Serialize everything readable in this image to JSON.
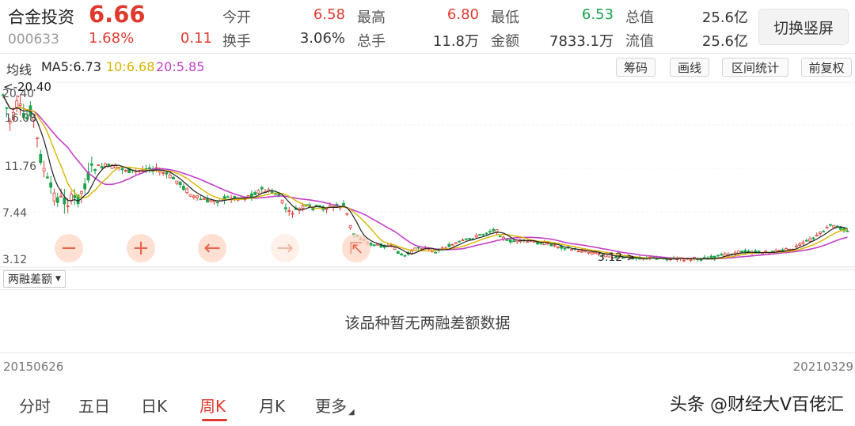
{
  "quote": {
    "name": "合金投资",
    "price": "6.66",
    "code": "000633",
    "change_pct": "1.68%",
    "change": "0.11",
    "fields": [
      {
        "label": "今开",
        "value": "6.58",
        "color": "red"
      },
      {
        "label": "最高",
        "value": "6.80",
        "color": "red"
      },
      {
        "label": "最低",
        "value": "6.53",
        "color": "green"
      },
      {
        "label": "总值",
        "value": "25.6亿",
        "color": "dark"
      },
      {
        "label": "换手",
        "value": "3.06%",
        "color": "dark"
      },
      {
        "label": "总手",
        "value": "11.8万",
        "color": "dark"
      },
      {
        "label": "金额",
        "value": "7833.1万",
        "color": "dark"
      },
      {
        "label": "流值",
        "value": "25.6亿",
        "color": "dark"
      }
    ]
  },
  "switch_button": "切换竖屏",
  "ma": {
    "title": "均线",
    "ma5": "MA5:6.73",
    "ma10": "10:6.68",
    "ma20": "20:5.85",
    "colors": {
      "ma5": "#222222",
      "ma10": "#d9b400",
      "ma20": "#c23fc8"
    }
  },
  "tools": [
    "筹码",
    "画线",
    "区间统计",
    "前复权"
  ],
  "chart": {
    "y_labels": [
      "20.40",
      "16.08",
      "11.76",
      "7.44",
      "3.12"
    ],
    "max_marker": "<-20.40",
    "min_marker": "3.12->",
    "start_date": "20150626",
    "end_date": "20210329",
    "up_color": "#e03a2e",
    "down_color": "#1aa34a"
  },
  "zoom_controls": [
    "minus-icon",
    "plus-icon",
    "arrow-left-icon",
    "arrow-right-icon",
    "arrow-left-end-icon"
  ],
  "sub_chart": {
    "indicator": "两融差额",
    "empty_message": "该品种暂无两融差额数据"
  },
  "tabs": [
    {
      "label": "分时",
      "active": false
    },
    {
      "label": "五日",
      "active": false
    },
    {
      "label": "日K",
      "active": false
    },
    {
      "label": "周K",
      "active": true
    },
    {
      "label": "月K",
      "active": false
    },
    {
      "label": "更多",
      "active": false
    }
  ],
  "watermark": "头条 @财经大V百佬汇"
}
